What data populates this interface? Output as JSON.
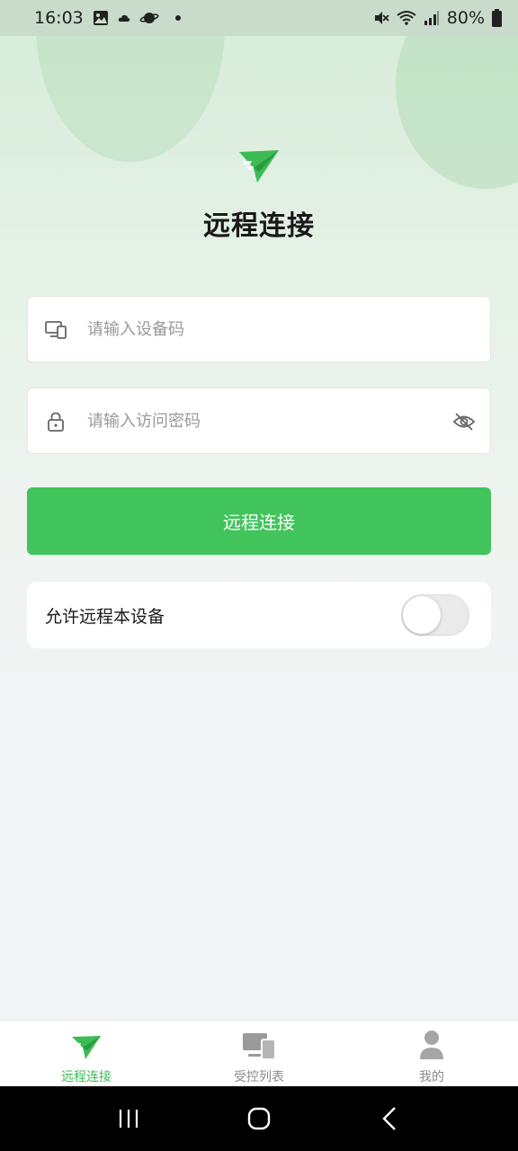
{
  "status_bar": {
    "time": "16:03",
    "battery": "80%",
    "icons": [
      "gallery-icon",
      "cloud-icon",
      "saturn-icon",
      "notification-dot",
      "mute-icon",
      "wifi-icon",
      "signal-icon",
      "battery-icon"
    ]
  },
  "header": {
    "title": "远程连接",
    "logo_icon": "paper-plane-logo"
  },
  "form": {
    "device_code": {
      "value": "",
      "placeholder": "请输入设备码",
      "icon": "devices-icon"
    },
    "password": {
      "value": "",
      "placeholder": "请输入访问密码",
      "icon": "lock-icon",
      "toggle_icon": "eye-off-icon"
    },
    "connect_button": "远程连接"
  },
  "allow_remote": {
    "label": "允许远程本设备",
    "enabled": false
  },
  "tabbar": {
    "items": [
      {
        "label": "远程连接",
        "icon": "paper-plane-icon",
        "active": true
      },
      {
        "label": "受控列表",
        "icon": "devices-icon",
        "active": false
      },
      {
        "label": "我的",
        "icon": "person-icon",
        "active": false
      }
    ]
  },
  "colors": {
    "accent": "#42c45c",
    "active_tab": "#3dbb55",
    "inactive_tab": "#8a8a8a"
  }
}
